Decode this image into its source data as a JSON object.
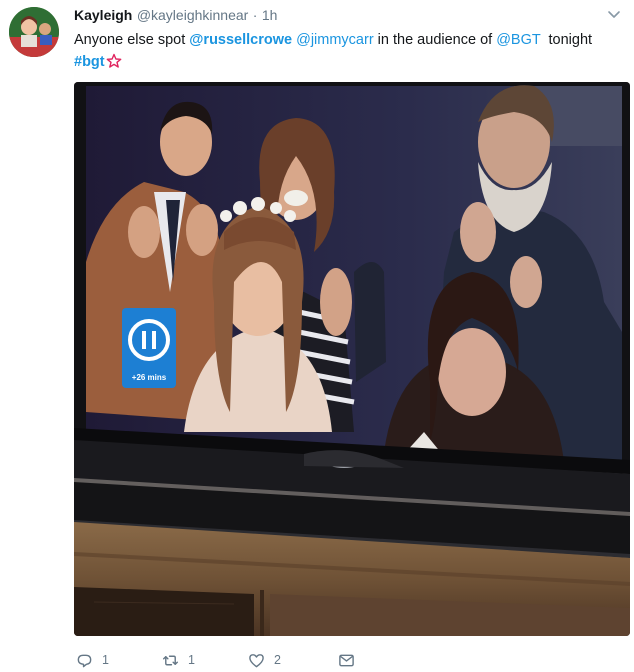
{
  "tweet": {
    "author_name": "Kayleigh",
    "author_handle": "@kayleighkinnear",
    "separator": "·",
    "timestamp": "1h",
    "text_before": "Anyone else spot ",
    "mention_1": "@russellcrowe",
    "mention_2": "@jimmycarr",
    "text_mid": " in the audience of ",
    "mention_3": "@BGT",
    "text_after": "  tonight",
    "hashtag": "#bgt"
  },
  "media": {
    "tv_overlay_label": "+26 mins"
  },
  "actions": {
    "reply_count": "1",
    "retweet_count": "1",
    "like_count": "2"
  },
  "colors": {
    "link": "#1b95e0",
    "muted": "#657786",
    "text": "#14171a",
    "pause_badge": "#1d7fd3"
  },
  "icons": {
    "reply": "reply-icon",
    "retweet": "retweet-icon",
    "like": "heart-icon",
    "dm": "envelope-icon",
    "menu": "chevron-down-icon",
    "hashflag": "star-hashflag-icon"
  }
}
